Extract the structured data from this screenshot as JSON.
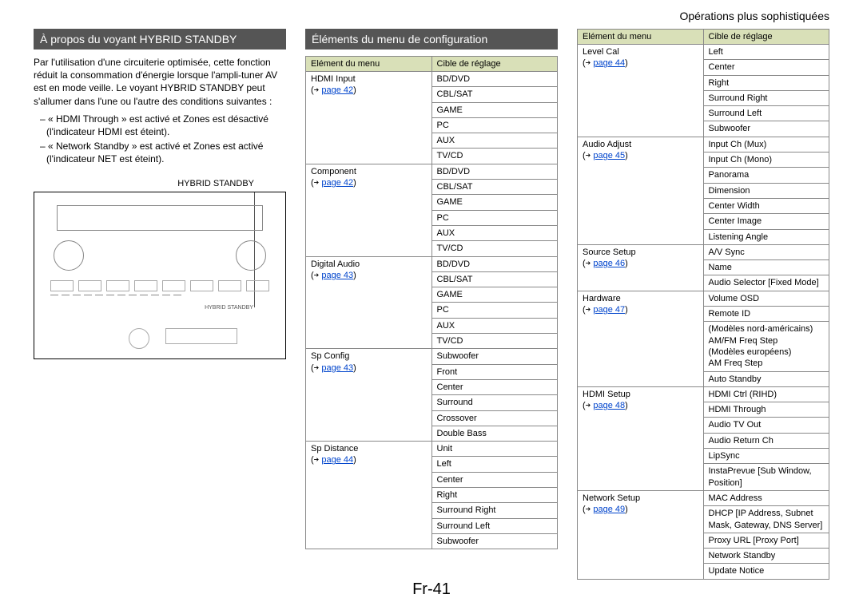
{
  "page_header": "Opérations plus sophistiquées",
  "page_number": "Fr-41",
  "section1": {
    "title": "À propos du voyant HYBRID STANDBY",
    "para": "Par l'utilisation d'une circuiterie optimisée, cette fonction réduit la consommation d'énergie lorsque l'ampli-tuner AV est en mode veille. Le voyant HYBRID STANDBY peut s'allumer dans l'une ou l'autre des conditions suivantes :",
    "bullet1": "– « HDMI Through » est activé et Zones est désactivé (l'indicateur HDMI est éteint).",
    "bullet2": "– « Network Standby » est activé et Zones est activé (l'indicateur NET est éteint).",
    "diagram_label": "HYBRID STANDBY"
  },
  "section2": {
    "title": "Éléments du menu de configuration",
    "table_head_menu": "Elément du menu",
    "table_head_target": "Cible de réglage"
  },
  "tableA": [
    {
      "menu": "HDMI Input",
      "page": "page 42",
      "targets": [
        "BD/DVD",
        "CBL/SAT",
        "GAME",
        "PC",
        "AUX",
        "TV/CD"
      ]
    },
    {
      "menu": "Component",
      "page": "page 42",
      "targets": [
        "BD/DVD",
        "CBL/SAT",
        "GAME",
        "PC",
        "AUX",
        "TV/CD"
      ]
    },
    {
      "menu": "Digital Audio",
      "page": "page 43",
      "targets": [
        "BD/DVD",
        "CBL/SAT",
        "GAME",
        "PC",
        "AUX",
        "TV/CD"
      ]
    },
    {
      "menu": "Sp Config",
      "page": "page 43",
      "targets": [
        "Subwoofer",
        "Front",
        "Center",
        "Surround",
        "Crossover",
        "Double Bass"
      ]
    },
    {
      "menu": "Sp Distance",
      "page": "page 44",
      "targets": [
        "Unit",
        "Left",
        "Center",
        "Right",
        "Surround Right",
        "Surround Left",
        "Subwoofer"
      ]
    }
  ],
  "tableB": [
    {
      "menu": "Level Cal",
      "page": "page 44",
      "targets": [
        "Left",
        "Center",
        "Right",
        "Surround Right",
        "Surround Left",
        "Subwoofer"
      ]
    },
    {
      "menu": "Audio Adjust",
      "page": "page 45",
      "targets": [
        "Input Ch (Mux)",
        "Input Ch (Mono)",
        "Panorama",
        "Dimension",
        "Center Width",
        "Center Image",
        "Listening Angle"
      ]
    },
    {
      "menu": "Source Setup",
      "page": "page 46",
      "targets": [
        "A/V Sync",
        "Name",
        "Audio Selector [Fixed Mode]"
      ]
    },
    {
      "menu": "Hardware",
      "page": "page 47",
      "targets": [
        "Volume OSD",
        "Remote ID",
        "(Modèles nord-américains)\nAM/FM Freq Step\n(Modèles européens)\nAM Freq Step",
        "Auto Standby"
      ]
    },
    {
      "menu": "HDMI Setup",
      "page": "page 48",
      "targets": [
        "HDMI Ctrl (RIHD)",
        "HDMI Through",
        "Audio TV Out",
        "Audio Return Ch",
        "LipSync",
        "InstaPrevue [Sub Window, Position]"
      ]
    },
    {
      "menu": "Network Setup",
      "page": "page 49",
      "targets": [
        "MAC Address",
        "DHCP [IP Address, Subnet Mask, Gateway, DNS Server]",
        "Proxy URL [Proxy Port]",
        "Network Standby",
        "Update Notice"
      ]
    }
  ],
  "arrow_glyph": "➔"
}
